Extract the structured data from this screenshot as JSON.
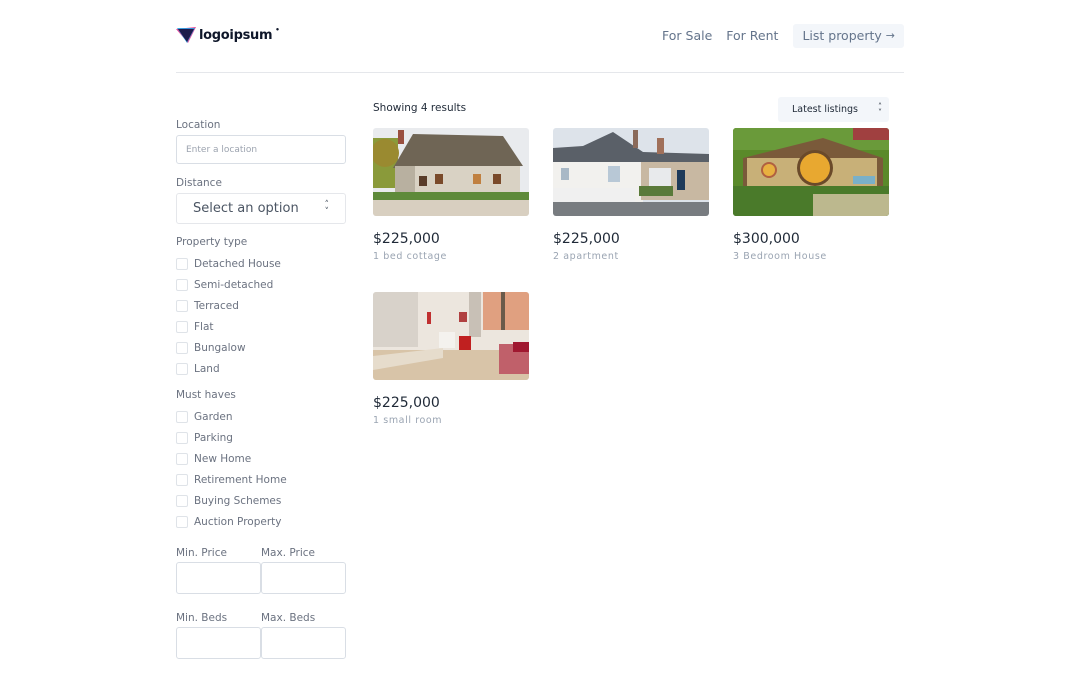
{
  "header": {
    "logo_text": "logoipsum",
    "nav": [
      {
        "label": "For Sale"
      },
      {
        "label": "For Rent"
      },
      {
        "label": "List property",
        "icon": "arrow-right-icon",
        "arrow": "→"
      }
    ]
  },
  "filters": {
    "location": {
      "label": "Location",
      "placeholder": "Enter a location",
      "value": ""
    },
    "distance": {
      "label": "Distance",
      "selected": "Select an option"
    },
    "property_type": {
      "title": "Property type",
      "options": [
        {
          "label": "Detached House",
          "checked": false
        },
        {
          "label": "Semi-detached",
          "checked": false
        },
        {
          "label": "Terraced",
          "checked": false
        },
        {
          "label": "Flat",
          "checked": false
        },
        {
          "label": "Bungalow",
          "checked": false
        },
        {
          "label": "Land",
          "checked": false
        }
      ]
    },
    "must_haves": {
      "title": "Must haves",
      "options": [
        {
          "label": "Garden",
          "checked": false
        },
        {
          "label": "Parking",
          "checked": false
        },
        {
          "label": "New Home",
          "checked": false
        },
        {
          "label": "Retirement Home",
          "checked": false
        },
        {
          "label": "Buying Schemes",
          "checked": false
        },
        {
          "label": "Auction Property",
          "checked": false
        }
      ]
    },
    "min_price": {
      "label": "Min. Price",
      "value": ""
    },
    "max_price": {
      "label": "Max. Price",
      "value": ""
    },
    "min_beds": {
      "label": "Min. Beds",
      "value": ""
    },
    "max_beds": {
      "label": "Max. Beds",
      "value": ""
    }
  },
  "results": {
    "count_text": "Showing 4 results",
    "sort": {
      "selected": "Latest listings"
    },
    "listings": [
      {
        "price": "$225,000",
        "description": "1 bed cottage",
        "image": "thatched-cottage-photo"
      },
      {
        "price": "$225,000",
        "description": "2 apartment",
        "image": "terraced-house-photo"
      },
      {
        "price": "$300,000",
        "description": "3 Bedroom House",
        "image": "hobbit-house-photo"
      },
      {
        "price": "$225,000",
        "description": "1 small room",
        "image": "living-room-photo"
      }
    ]
  }
}
